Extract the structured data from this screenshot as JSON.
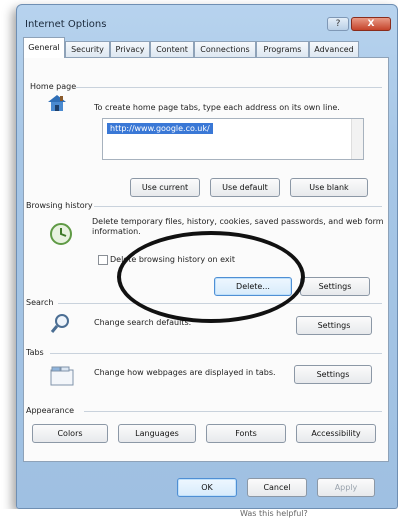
{
  "window": {
    "title": "Internet Options",
    "help_glyph": "?",
    "close_glyph": "X"
  },
  "tabs": [
    "General",
    "Security",
    "Privacy",
    "Content",
    "Connections",
    "Programs",
    "Advanced"
  ],
  "home_page": {
    "title": "Home page",
    "description": "To create home page tabs, type each address on its own line.",
    "url": "http://www.google.co.uk/",
    "buttons": {
      "use_current": "Use current",
      "use_default": "Use default",
      "use_blank": "Use blank"
    }
  },
  "browsing_history": {
    "title": "Browsing history",
    "description": "Delete temporary files, history, cookies, saved passwords, and web form information.",
    "checkbox_label": "Delete browsing history on exit",
    "delete_button": "Delete...",
    "settings_button": "Settings"
  },
  "search": {
    "title": "Search",
    "description": "Change search defaults.",
    "settings_button": "Settings"
  },
  "tabs_section": {
    "title": "Tabs",
    "description": "Change how webpages are displayed in tabs.",
    "settings_button": "Settings"
  },
  "appearance": {
    "title": "Appearance",
    "buttons": {
      "colors": "Colors",
      "languages": "Languages",
      "fonts": "Fonts",
      "accessibility": "Accessibility"
    }
  },
  "footer": {
    "ok": "OK",
    "cancel": "Cancel",
    "apply": "Apply"
  },
  "background_text": "Was this helpful?",
  "colors": {
    "accent": "#3a78d6",
    "close": "#c4432a",
    "annotation": "#111111"
  }
}
